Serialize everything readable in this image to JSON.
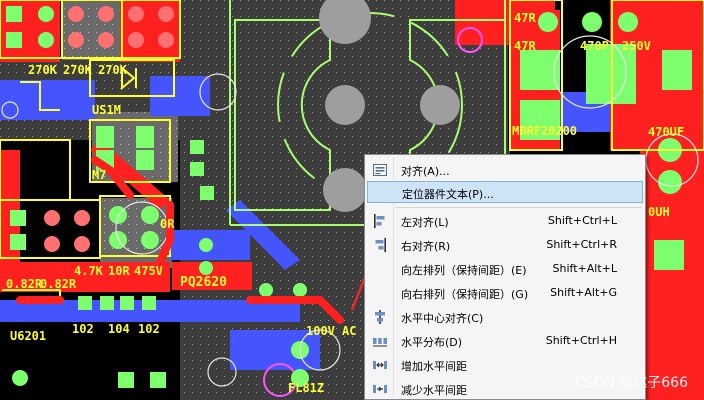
{
  "colors": {
    "top_copper": "#ff2020",
    "bottom_copper": "#4455ff",
    "pads": "#7dff6e",
    "silkscreen": "#ffff33",
    "board_outline": "#a7ff6e",
    "menu_highlight": "#cde4f7",
    "annotation_arrow": "#e52b2b"
  },
  "pcb": {
    "labels": [
      "270K",
      "270K",
      "270K",
      "US1M",
      "M7",
      "0R",
      "4.7K",
      "PQ2620",
      "10R",
      "475V",
      "100V",
      "U6201",
      "0.82R",
      "0.82R",
      "102",
      "104",
      "102",
      "47R",
      "47R",
      "470P",
      "250V",
      "MBRF20200",
      "470UF",
      "0UH",
      "FL81Z",
      "AC"
    ]
  },
  "context_menu": {
    "items": [
      {
        "label": "对齐(A)...",
        "shortcut": "",
        "icon": "align-dialog-icon"
      },
      {
        "label": "定位器件文本(P)...",
        "shortcut": "",
        "icon": "",
        "highlighted": true
      },
      {
        "label": "左对齐(L)",
        "shortcut": "Shift+Ctrl+L",
        "icon": "align-left-icon"
      },
      {
        "label": "右对齐(R)",
        "shortcut": "Shift+Ctrl+R",
        "icon": "align-right-icon"
      },
      {
        "label": "向左排列（保持间距）(E)",
        "shortcut": "Shift+Alt+L",
        "icon": ""
      },
      {
        "label": "向右排列（保持间距）(G)",
        "shortcut": "Shift+Alt+G",
        "icon": ""
      },
      {
        "label": "水平中心对齐(C)",
        "shortcut": "",
        "icon": "align-horizontal-center-icon"
      },
      {
        "label": "水平分布(D)",
        "shortcut": "Shift+Ctrl+H",
        "icon": "distribute-horizontal-icon"
      },
      {
        "label": "增加水平间距",
        "shortcut": "",
        "icon": "increase-horizontal-spacing-icon"
      },
      {
        "label": "减少水平间距",
        "shortcut": "",
        "icon": "decrease-horizontal-spacing-icon"
      }
    ]
  },
  "watermark": "CSDN @达子666"
}
